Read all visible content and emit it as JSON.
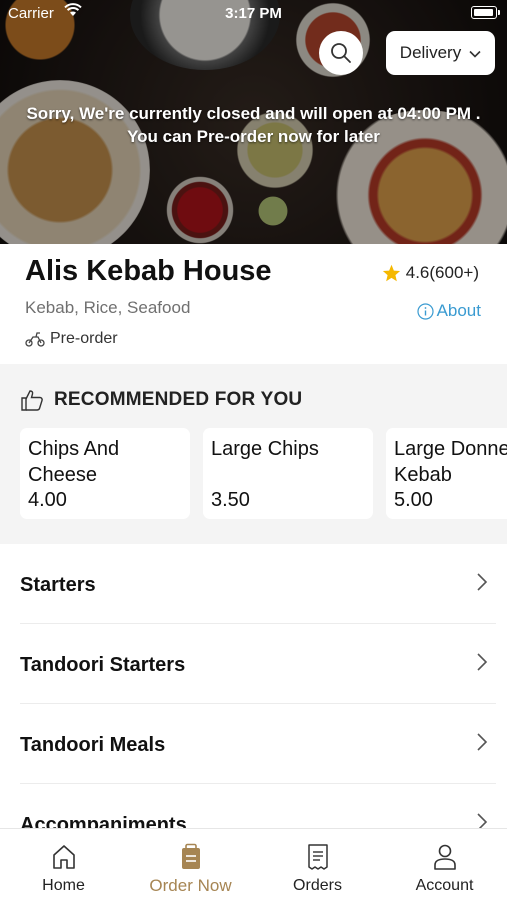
{
  "status_bar": {
    "carrier": "Carrier",
    "time": "3:17 PM"
  },
  "header": {
    "delivery_label": "Delivery",
    "closed_line1": "Sorry, We're currently closed and will open at 04:00 PM .",
    "closed_line2": "You can Pre-order now for later"
  },
  "restaurant": {
    "name": "Alis Kebab House",
    "rating": "4.6(600+)",
    "cuisine": "Kebab, Rice, Seafood",
    "about_label": "About",
    "preorder_label": "Pre-order"
  },
  "recommended": {
    "title": "RECOMMENDED FOR YOU",
    "items": [
      {
        "name": "Chips And\nCheese",
        "price": "4.00"
      },
      {
        "name": "Large Chips",
        "price": "3.50"
      },
      {
        "name": "Large Donner\nKebab",
        "price": "5.00"
      }
    ]
  },
  "categories": [
    {
      "label": "Starters"
    },
    {
      "label": "Tandoori Starters"
    },
    {
      "label": "Tandoori Meals"
    },
    {
      "label": "Accompaniments"
    }
  ],
  "tabs": [
    {
      "label": "Home",
      "icon": "home-icon"
    },
    {
      "label": "Order Now",
      "icon": "order-bag-icon"
    },
    {
      "label": "Orders",
      "icon": "receipt-icon"
    },
    {
      "label": "Account",
      "icon": "person-icon"
    }
  ],
  "colors": {
    "accent": "#a68553",
    "link": "#3a9bd1",
    "star": "#f5b800",
    "section_bg": "#f4f4f4"
  }
}
